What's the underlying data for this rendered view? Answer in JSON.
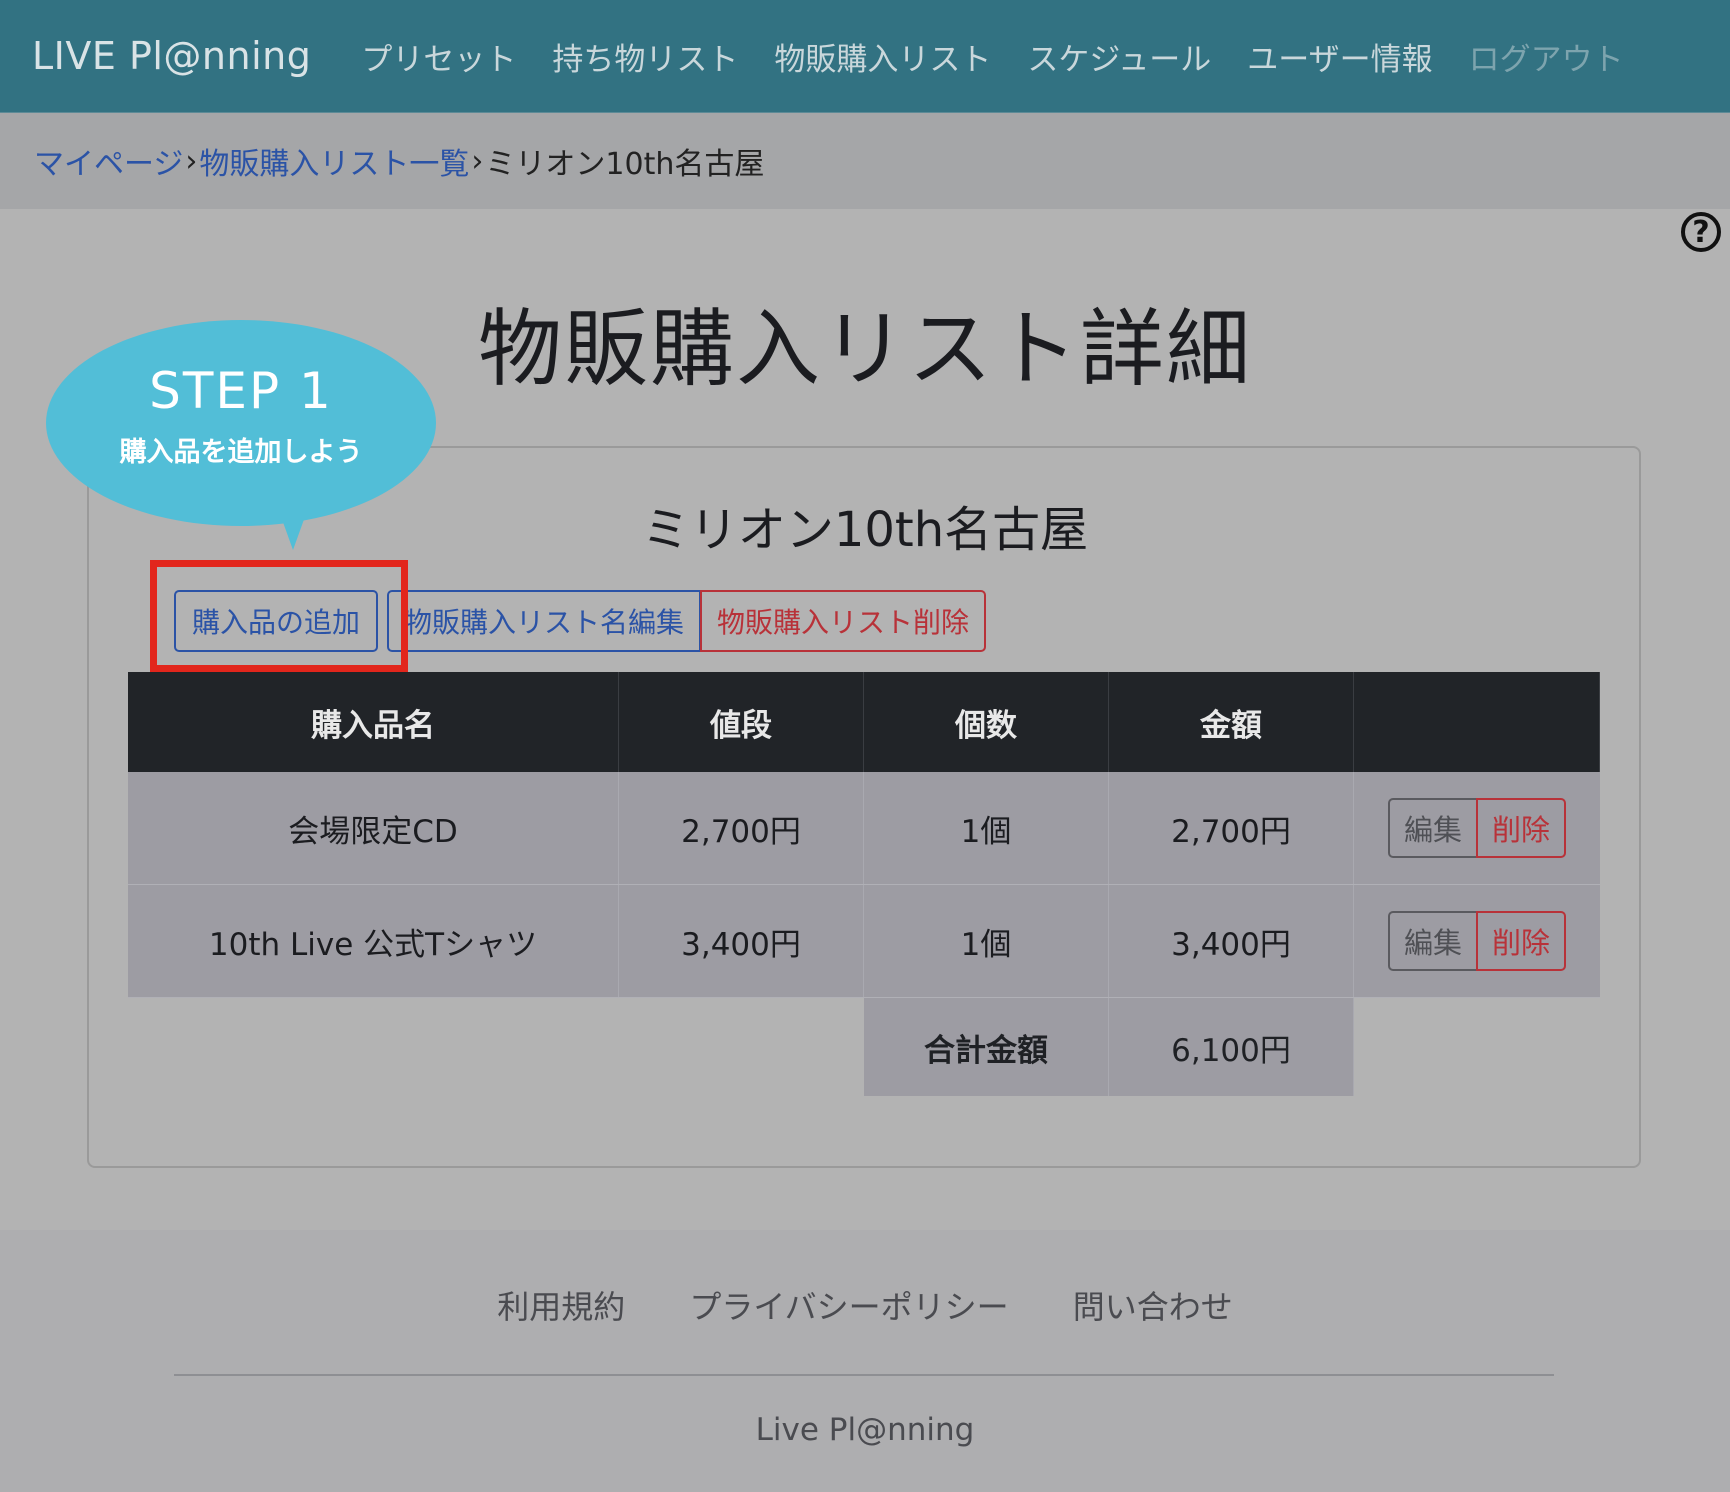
{
  "navbar": {
    "brand": "LIVE Pl@nning",
    "items": [
      {
        "label": "プリセット"
      },
      {
        "label": "持ち物リスト"
      },
      {
        "label": "物販購入リスト"
      },
      {
        "label": "スケジュール"
      },
      {
        "label": "ユーザー情報"
      },
      {
        "label": "ログアウト"
      }
    ]
  },
  "breadcrumb": {
    "items": [
      "マイページ",
      "物販購入リスト一覧",
      "ミリオン10th名古屋"
    ],
    "separator": "›"
  },
  "page": {
    "title": "物販購入リスト詳細",
    "list_name": "ミリオン10th名古屋"
  },
  "tutorial": {
    "step": "STEP 1",
    "text": "購入品を追加しよう"
  },
  "actions": {
    "add": "購入品の追加",
    "edit_name": "物販購入リスト名編集",
    "delete_list": "物販購入リスト削除"
  },
  "table": {
    "headers": [
      "購入品名",
      "値段",
      "個数",
      "金額",
      ""
    ],
    "rows": [
      {
        "name": "会場限定CD",
        "price": "2,700円",
        "qty": "1個",
        "amount": "2,700円",
        "edit": "編集",
        "delete": "削除"
      },
      {
        "name": "10th Live 公式Tシャツ",
        "price": "3,400円",
        "qty": "1個",
        "amount": "3,400円",
        "edit": "編集",
        "delete": "削除"
      }
    ],
    "total_label": "合計金額",
    "total_value": "6,100円"
  },
  "footer": {
    "links": [
      "利用規約",
      "プライバシーポリシー",
      "問い合わせ"
    ],
    "brand": "Live Pl@nning"
  },
  "colors": {
    "navbar": "#327282",
    "bubble": "#52bed7",
    "highlight": "#e2261c",
    "primary": "#2b53a6",
    "danger": "#b83239"
  },
  "icons": {
    "help": "question-circle-icon"
  }
}
